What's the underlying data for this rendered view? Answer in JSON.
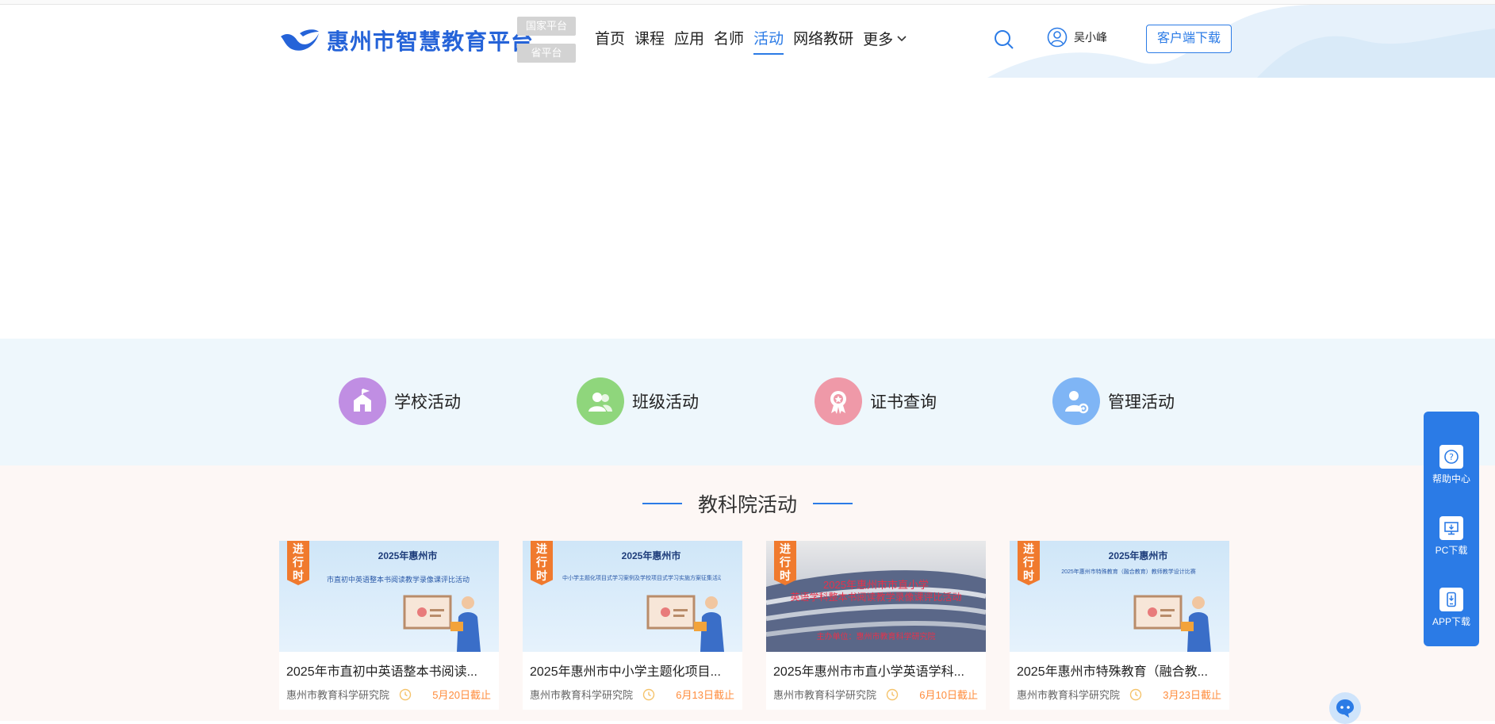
{
  "header": {
    "logo_text": "惠州市智慧教育平台",
    "badges": [
      "国家平台",
      "省平台"
    ],
    "nav": [
      "首页",
      "课程",
      "应用",
      "名师",
      "活动",
      "网络教研",
      "更多"
    ],
    "active_nav": "活动",
    "username": "吴小峰",
    "download_label": "客户端下载"
  },
  "categories": [
    {
      "label": "学校活动",
      "icon": "school-icon",
      "color": "#c08ee3"
    },
    {
      "label": "班级活动",
      "icon": "group-icon",
      "color": "#8fd67c"
    },
    {
      "label": "证书查询",
      "icon": "award-icon",
      "color": "#ef99a8"
    },
    {
      "label": "管理活动",
      "icon": "user-gear-icon",
      "color": "#7fb5f5"
    }
  ],
  "section": {
    "title": "教科院活动"
  },
  "cards": [
    {
      "ribbon": "进行时",
      "banner_title": "2025年惠州市",
      "banner_subtitle": "市直初中英语整本书阅读教学录像课评比活动",
      "title": "2025年市直初中英语整本书阅读...",
      "org": "惠州市教育科学研究院",
      "deadline": "5月20日截止"
    },
    {
      "ribbon": "进行时",
      "banner_title": "2025年惠州市",
      "banner_subtitle": "中小学主题化项目式学习案例及学校项目式学习实施方案征集活动",
      "title": "2025年惠州市中小学主题化项目...",
      "org": "惠州市教育科学研究院",
      "deadline": "6月13日截止"
    },
    {
      "ribbon": "进行时",
      "banner_title": "2025年惠州市市直小学",
      "banner_subtitle": "英语学科整本书阅读教学录像课评比活动",
      "banner_footer": "主办单位：惠州市教育科学研究院",
      "title": "2025年惠州市市直小学英语学科...",
      "org": "惠州市教育科学研究院",
      "deadline": "6月10日截止"
    },
    {
      "ribbon": "进行时",
      "banner_title": "2025年惠州市",
      "banner_subtitle": "2025年惠州市特殊教育（融合教育）教师教学设计比赛",
      "title": "2025年惠州市特殊教育（融合教...",
      "org": "惠州市教育科学研究院",
      "deadline": "3月23日截止"
    }
  ],
  "float_bar": [
    "帮助中心",
    "PC下载",
    "APP下载"
  ],
  "colors": {
    "accent": "#2b7be6",
    "deadline": "#ff8c3c",
    "ribbon": "#f07a2e"
  }
}
